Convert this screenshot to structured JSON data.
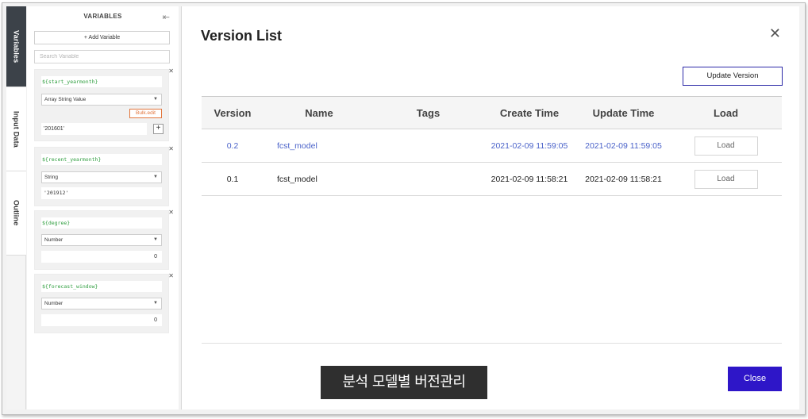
{
  "tabs": [
    {
      "label": "Variables",
      "active": true
    },
    {
      "label": "Input Data",
      "active": false
    },
    {
      "label": "Outline",
      "active": false
    }
  ],
  "variables_panel": {
    "title": "VARIABLES",
    "add_label": "+ Add Variable",
    "search_placeholder": "Search Variable",
    "cards": [
      {
        "name": "${start_yearmonth}",
        "type": "Array String Value",
        "bulk_label": "Bulk.edit",
        "value": "'201601'"
      },
      {
        "name": "${recent_yearmonth}",
        "type": "String",
        "value": "'201912'"
      },
      {
        "name": "${degree}",
        "type": "Number",
        "value": "0"
      },
      {
        "name": "${forecast_window}",
        "type": "Number",
        "value": "0"
      }
    ]
  },
  "dialog": {
    "title": "Version List",
    "update_label": "Update Version",
    "close_label": "Close",
    "columns": [
      "Version",
      "Name",
      "Tags",
      "Create Time",
      "Update Time",
      "Load"
    ],
    "rows": [
      {
        "version": "0.2",
        "name": "fcst_model",
        "tags": "",
        "create_time": "2021-02-09 11:59:05",
        "update_time": "2021-02-09 11:59:05",
        "load_label": "Load",
        "selected": true
      },
      {
        "version": "0.1",
        "name": "fcst_model",
        "tags": "",
        "create_time": "2021-02-09 11:58:21",
        "update_time": "2021-02-09 11:58:21",
        "load_label": "Load",
        "selected": false
      }
    ]
  },
  "caption": "분석 모델별 버전관리",
  "colors": {
    "accent_close": "#2e16c8",
    "link_blue": "#4a62c9",
    "var_name_green": "#2e9e3e",
    "bulk_orange": "#e2753c",
    "active_tab": "#3c4249"
  }
}
